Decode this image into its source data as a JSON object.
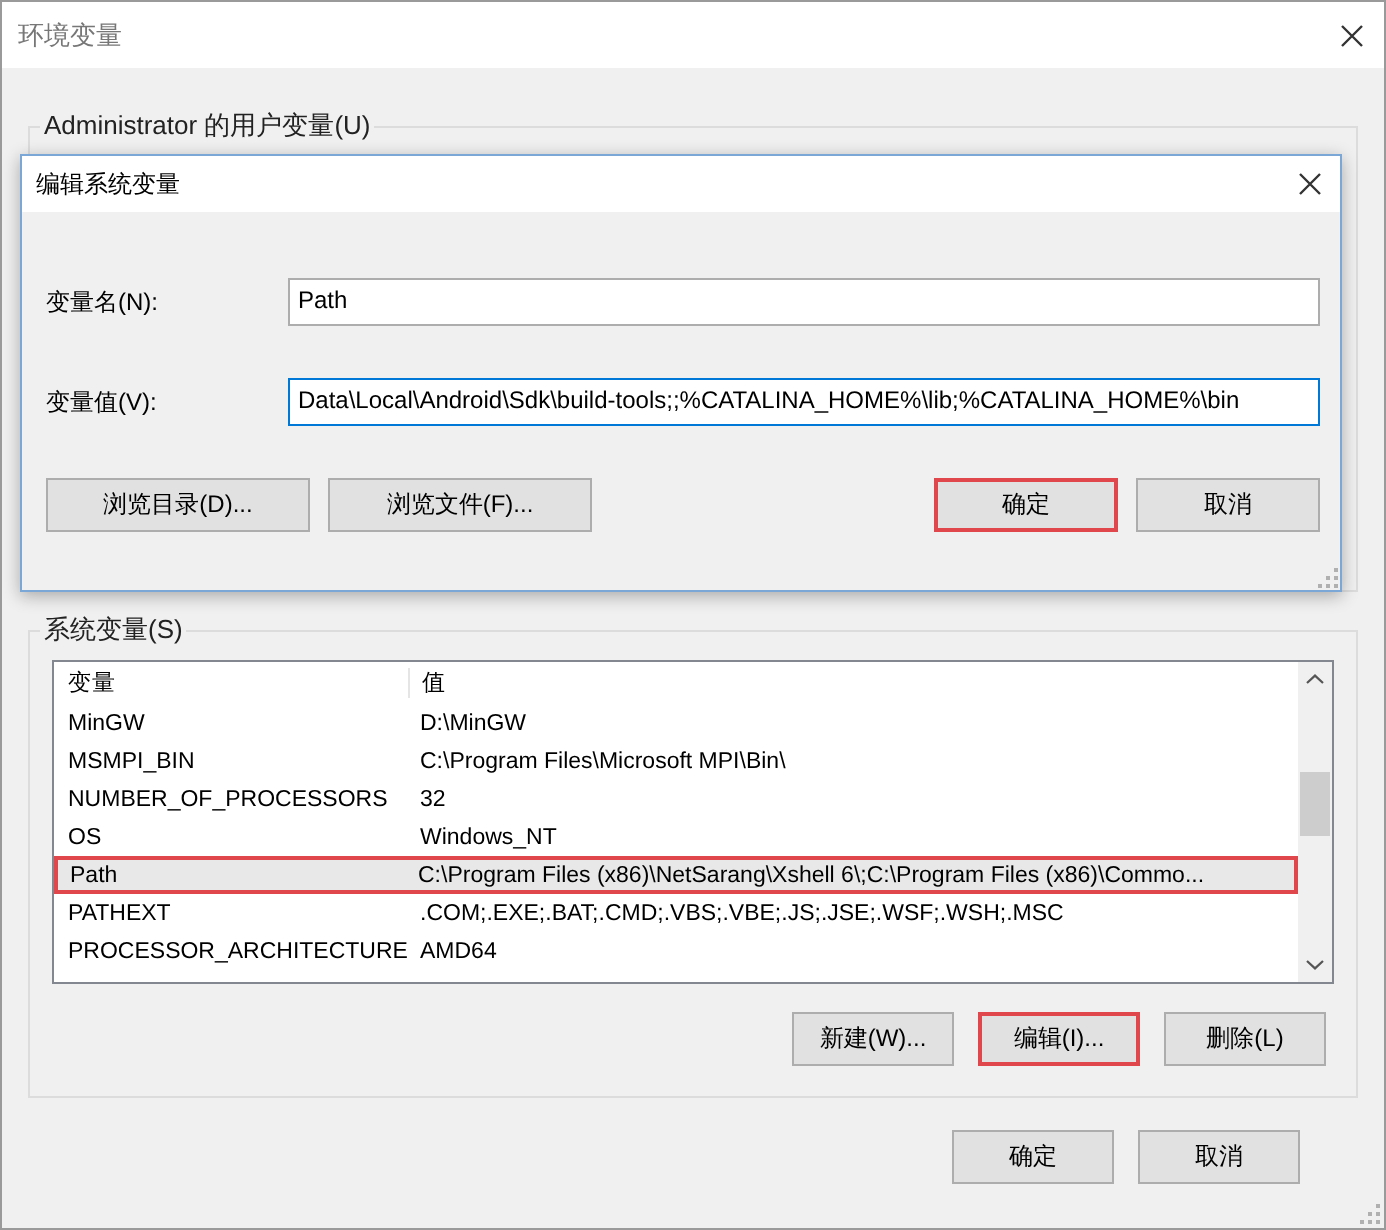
{
  "window": {
    "title": "环境变量"
  },
  "user_variables": {
    "label": "Administrator 的用户变量(U)"
  },
  "dialog": {
    "title": "编辑系统变量",
    "fields": [
      {
        "label": "变量名(N):",
        "value": "Path",
        "focused": false
      },
      {
        "label": "变量值(V):",
        "value": "Data\\Local\\Android\\Sdk\\build-tools;;%CATALINA_HOME%\\lib;%CATALINA_HOME%\\bin",
        "focused": true
      }
    ],
    "buttons": [
      {
        "label": "浏览目录(D)...",
        "kind": "left",
        "highlighted": false
      },
      {
        "label": "浏览文件(F)...",
        "kind": "left",
        "highlighted": false
      },
      {
        "label": "确定",
        "kind": "right",
        "highlighted": true
      },
      {
        "label": "取消",
        "kind": "right",
        "highlighted": false
      }
    ]
  },
  "system_variables": {
    "label": "系统变量(S)",
    "columns": [
      "变量",
      "值"
    ],
    "rows": [
      {
        "name": "MinGW",
        "value": "D:\\MinGW",
        "selected": false,
        "highlighted": false
      },
      {
        "name": "MSMPI_BIN",
        "value": "C:\\Program Files\\Microsoft MPI\\Bin\\",
        "selected": false,
        "highlighted": false
      },
      {
        "name": "NUMBER_OF_PROCESSORS",
        "value": "32",
        "selected": false,
        "highlighted": false
      },
      {
        "name": "OS",
        "value": "Windows_NT",
        "selected": false,
        "highlighted": false
      },
      {
        "name": "Path",
        "value": "C:\\Program Files (x86)\\NetSarang\\Xshell 6\\;C:\\Program Files (x86)\\Commo...",
        "selected": true,
        "highlighted": true
      },
      {
        "name": "PATHEXT",
        "value": ".COM;.EXE;.BAT;.CMD;.VBS;.VBE;.JS;.JSE;.WSF;.WSH;.MSC",
        "selected": false,
        "highlighted": false
      },
      {
        "name": "PROCESSOR_ARCHITECTURE",
        "value": "AMD64",
        "selected": false,
        "highlighted": false
      }
    ],
    "buttons": [
      {
        "label": "新建(W)...",
        "highlighted": false
      },
      {
        "label": "编辑(I)...",
        "highlighted": true
      },
      {
        "label": "删除(L)",
        "highlighted": false
      }
    ]
  },
  "buttons": [
    {
      "label": "确定",
      "highlighted": false
    },
    {
      "label": "取消",
      "highlighted": false
    }
  ]
}
